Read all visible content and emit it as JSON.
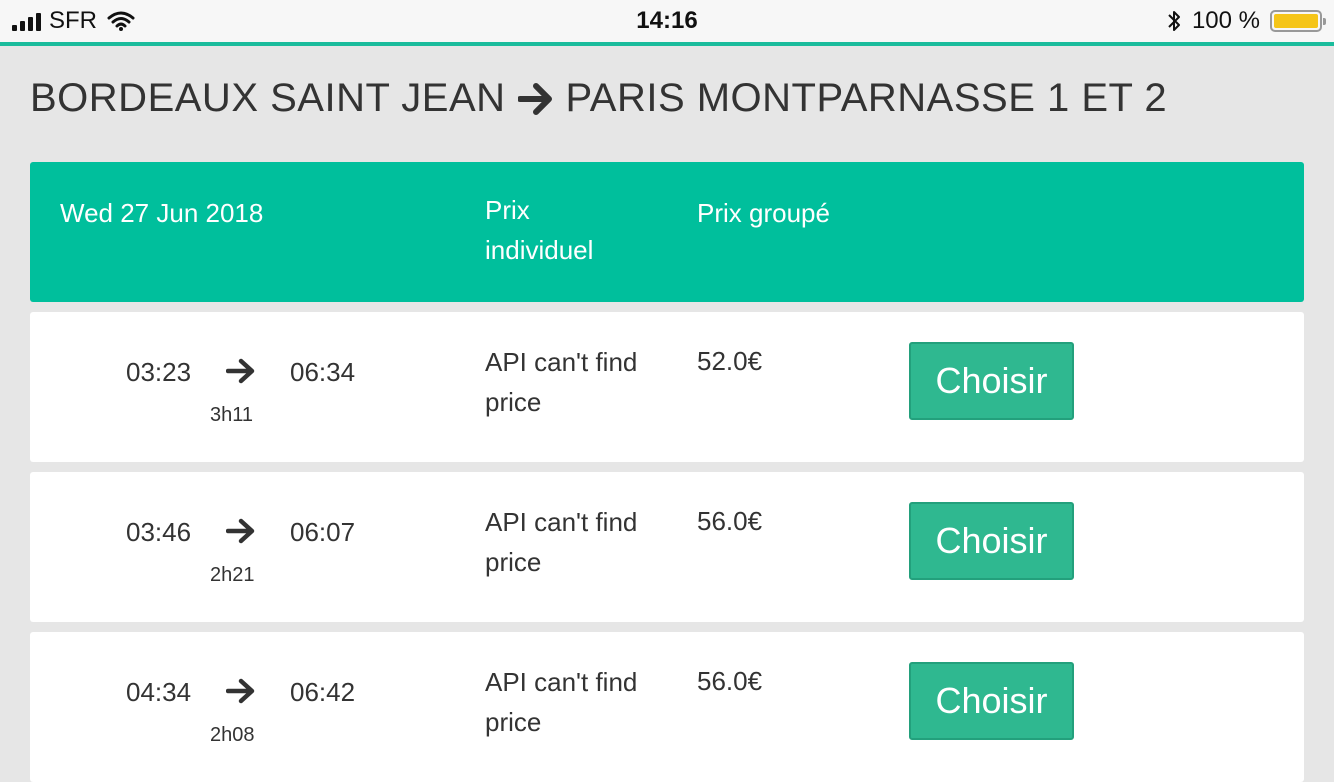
{
  "status_bar": {
    "carrier": "SFR",
    "time": "14:16",
    "battery_text": "100 %",
    "battery_color": "#f5c518"
  },
  "route": {
    "origin": "BORDEAUX SAINT JEAN",
    "destination": "PARIS MONTPARNASSE 1 ET 2"
  },
  "table_header": {
    "date": "Wed 27 Jun 2018",
    "individual_price_label": "Prix individuel",
    "group_price_label": "Prix groupé"
  },
  "trains": [
    {
      "departure": "03:23",
      "arrival": "06:34",
      "duration": "3h11",
      "individual_price": "API can't find price",
      "group_price": "52.0€",
      "button_label": "Choisir"
    },
    {
      "departure": "03:46",
      "arrival": "06:07",
      "duration": "2h21",
      "individual_price": "API can't find price",
      "group_price": "56.0€",
      "button_label": "Choisir"
    },
    {
      "departure": "04:34",
      "arrival": "06:42",
      "duration": "2h08",
      "individual_price": "API can't find price",
      "group_price": "56.0€",
      "button_label": "Choisir"
    }
  ],
  "colors": {
    "accent": "#00bf9c",
    "button": "#2fb890",
    "background": "#e6e6e6"
  }
}
